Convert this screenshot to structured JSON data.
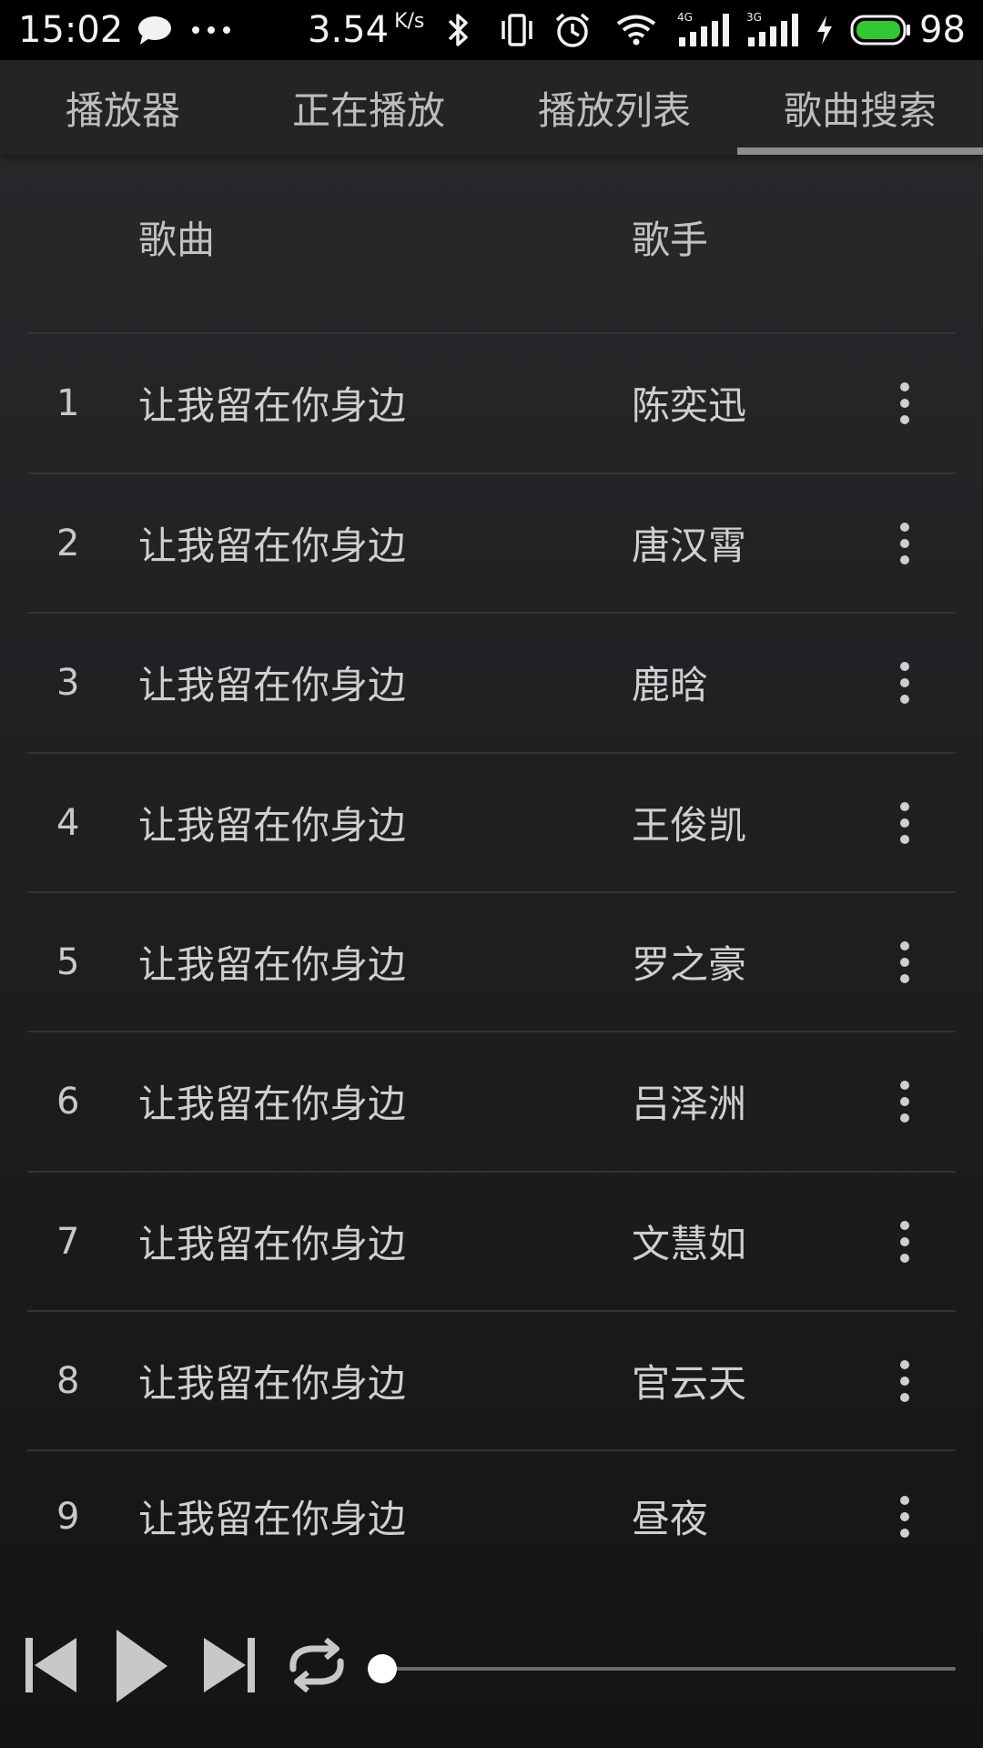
{
  "status_bar": {
    "time": "15:02",
    "network_speed": "3.54",
    "network_speed_unit": "K/s",
    "network_types": [
      "4G",
      "3G"
    ],
    "battery_level": "98",
    "icons": [
      "chat-bubble-icon",
      "more-dots-icon",
      "bluetooth-icon",
      "vibrate-icon",
      "alarm-icon",
      "wifi-icon",
      "signal-4g-icon",
      "signal-3g-icon",
      "charging-icon",
      "battery-icon"
    ],
    "battery_color": "#31c831"
  },
  "tabs": [
    {
      "label": "播放器",
      "active": false
    },
    {
      "label": "正在播放",
      "active": false
    },
    {
      "label": "播放列表",
      "active": false
    },
    {
      "label": "歌曲搜索",
      "active": true
    }
  ],
  "list": {
    "header": {
      "song": "歌曲",
      "singer": "歌手"
    },
    "rows": [
      {
        "num": "1",
        "song": "让我留在你身边",
        "singer": "陈奕迅"
      },
      {
        "num": "2",
        "song": "让我留在你身边",
        "singer": "唐汉霄"
      },
      {
        "num": "3",
        "song": "让我留在你身边",
        "singer": "鹿晗"
      },
      {
        "num": "4",
        "song": "让我留在你身边",
        "singer": "王俊凯"
      },
      {
        "num": "5",
        "song": "让我留在你身边",
        "singer": "罗之豪"
      },
      {
        "num": "6",
        "song": "让我留在你身边",
        "singer": "吕泽洲"
      },
      {
        "num": "7",
        "song": "让我留在你身边",
        "singer": "文慧如"
      },
      {
        "num": "8",
        "song": "让我留在你身边",
        "singer": "官云天"
      },
      {
        "num": "9",
        "song": "让我留在你身边",
        "singer": "昼夜"
      }
    ],
    "row_menu_icon": "more-vertical-icon"
  },
  "player": {
    "controls": [
      "previous-icon",
      "play-icon",
      "next-icon",
      "repeat-icon"
    ],
    "progress": 0
  },
  "colors": {
    "background": "#1c1b1d",
    "tab_indicator": "#8d8d8f",
    "text": "#cfcfd1"
  }
}
